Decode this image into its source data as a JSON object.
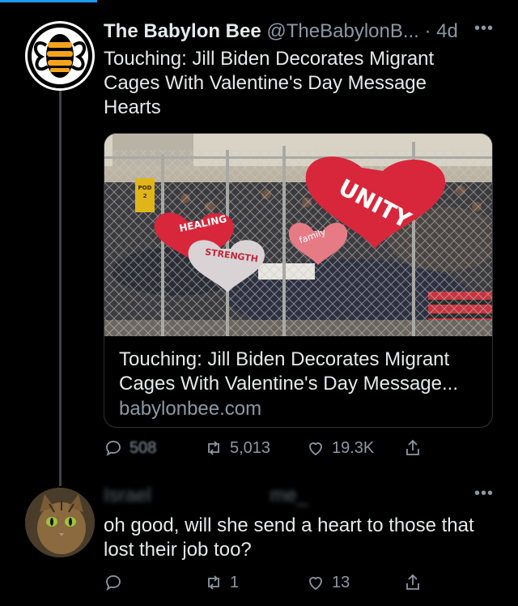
{
  "tweet": {
    "display_name": "The Babylon Bee",
    "handle_time": "@TheBabylonB... · 4d",
    "text": "Touching: Jill Biden Decorates Migrant Cages With Valentine's Day Message Hearts",
    "card": {
      "title": "Touching: Jill Biden Decorates Migrant Cages With Valentine's Day Message...",
      "domain": "babylonbee.com",
      "hearts": [
        "HEALING",
        "STRENGTH",
        "UNITY",
        "family"
      ],
      "sign": "POD 2"
    },
    "actions": {
      "replies": "508",
      "retweets": "5,013",
      "likes": "19.3K"
    }
  },
  "reply": {
    "display_name": "Israel",
    "handle_fragment": "me_",
    "text": "oh good, will she send a heart to those that lost their job too?",
    "actions": {
      "replies": "",
      "retweets": "1",
      "likes": "13"
    }
  },
  "icons": {
    "reply": "reply-icon",
    "retweet": "retweet-icon",
    "like": "like-icon",
    "share": "share-icon",
    "more": "more-icon"
  },
  "colors": {
    "background": "#000000",
    "text": "#e7e9ea",
    "muted": "#8b98a5",
    "accent": "#1d9bf0",
    "heart_red": "#d8263a"
  }
}
